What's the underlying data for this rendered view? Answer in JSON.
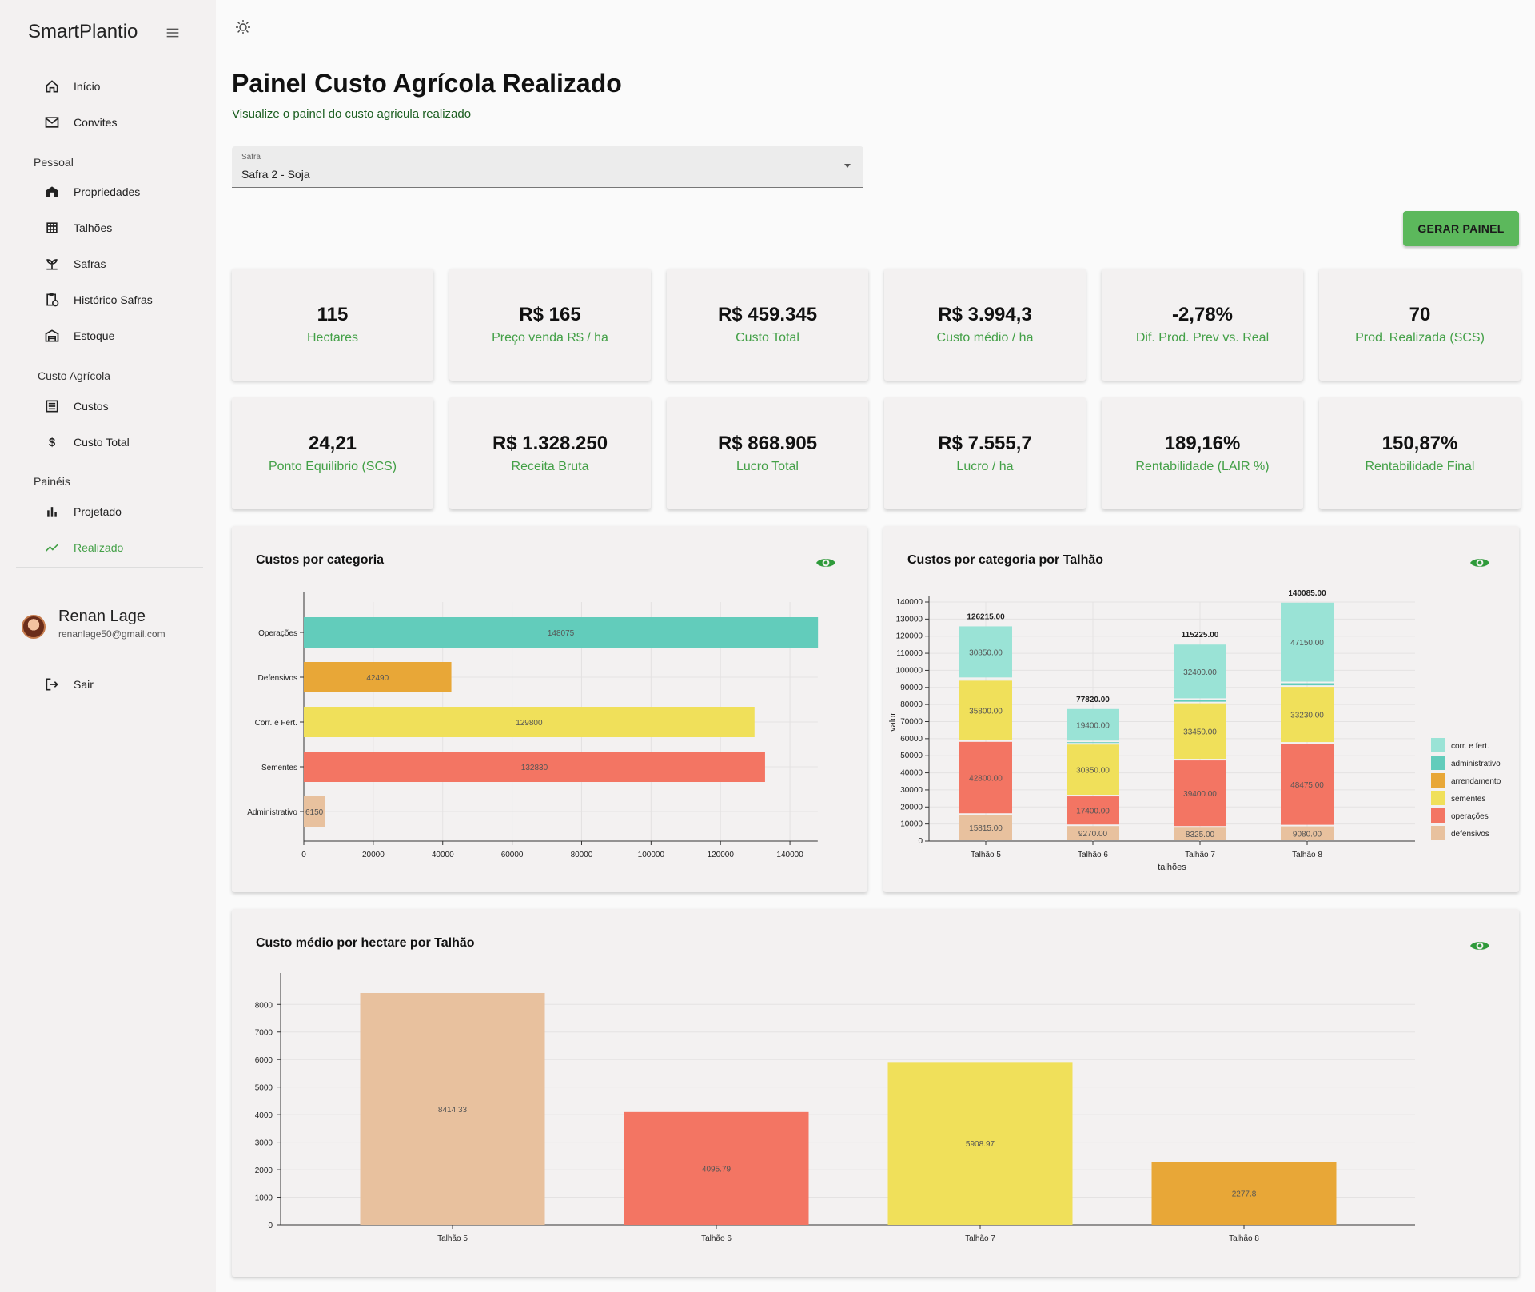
{
  "sidebar": {
    "brand": "SmartPlantio",
    "items": [
      {
        "label": "Início",
        "icon": "home-icon"
      },
      {
        "label": "Convites",
        "icon": "mail-icon"
      },
      {
        "label": "Propriedades",
        "icon": "barn-icon"
      },
      {
        "label": "Talhões",
        "icon": "grid-icon"
      },
      {
        "label": "Safras",
        "icon": "sprout-icon"
      },
      {
        "label": "Histórico Safras",
        "icon": "clipboard-history-icon"
      },
      {
        "label": "Estoque",
        "icon": "warehouse-icon"
      },
      {
        "label": "Custos",
        "icon": "list-icon"
      },
      {
        "label": "Custo Total",
        "icon": "dollar-icon"
      },
      {
        "label": "Projetado",
        "icon": "bar-chart-icon"
      },
      {
        "label": "Realizado",
        "icon": "trending-up-icon"
      }
    ],
    "sections": {
      "pessoal": "Pessoal",
      "custo": "Custo Agrícola",
      "paineis": "Painéis"
    },
    "user": {
      "name": "Renan Lage",
      "email": "renanlage50@gmail.com"
    },
    "logout": "Sair"
  },
  "header": {
    "title": "Painel Custo Agrícola Realizado",
    "subtitle": "Visualize o painel do custo agricula realizado"
  },
  "safra_select": {
    "label": "Safra",
    "value": "Safra 2 - Soja"
  },
  "generate_button": "GERAR PAINEL",
  "kpis": [
    {
      "value": "115",
      "label": "Hectares"
    },
    {
      "value": "R$ 165",
      "label": "Preço venda R$ / ha"
    },
    {
      "value": "R$ 459.345",
      "label": "Custo Total"
    },
    {
      "value": "R$ 3.994,3",
      "label": "Custo médio / ha"
    },
    {
      "value": "-2,78%",
      "label": "Dif. Prod. Prev vs. Real"
    },
    {
      "value": "70",
      "label": "Prod. Realizada (SCS)"
    },
    {
      "value": "24,21",
      "label": "Ponto Equilibrio (SCS)"
    },
    {
      "value": "R$ 1.328.250",
      "label": "Receita Bruta"
    },
    {
      "value": "R$ 868.905",
      "label": "Lucro Total"
    },
    {
      "value": "R$ 7.555,7",
      "label": "Lucro / ha"
    },
    {
      "value": "189,16%",
      "label": "Rentabilidade (LAIR %)"
    },
    {
      "value": "150,87%",
      "label": "Rentabilidade Final"
    }
  ],
  "colors": {
    "green": "#43a047",
    "operacoes": "#f37563",
    "defensivos": "#e8c19e",
    "corr_fert": "#9ae3d6",
    "administrativo": "#62ccbb",
    "arrendamento": "#e8a737",
    "sementes": "#f0e05a"
  },
  "chart_data": [
    {
      "type": "bar",
      "orientation": "horizontal",
      "title": "Custos por categoria",
      "categories": [
        "Operações",
        "Defensivos",
        "Corr. e Fert.",
        "Sementes",
        "Administrativo"
      ],
      "values": [
        148075,
        42490,
        129800,
        132830,
        6150
      ],
      "bar_colors": [
        "#62ccbb",
        "#e8a737",
        "#f0e05a",
        "#f37563",
        "#e8c19e"
      ],
      "xlim": [
        0,
        150000
      ],
      "xticks": [
        0,
        20000,
        40000,
        60000,
        80000,
        100000,
        120000,
        140000
      ],
      "grid": true
    },
    {
      "type": "bar",
      "stacked": true,
      "title": "Custos por categoria por Talhão",
      "categories": [
        "Talhão 5",
        "Talhão 6",
        "Talhão 7",
        "Talhão 8"
      ],
      "xlabel": "talhões",
      "ylabel": "valor",
      "ylim": [
        0,
        140000
      ],
      "yticks": [
        0,
        10000,
        20000,
        30000,
        40000,
        50000,
        60000,
        70000,
        80000,
        90000,
        100000,
        110000,
        120000,
        130000,
        140000
      ],
      "series": [
        {
          "name": "defensivos",
          "color": "#e8c19e",
          "values": [
            15815,
            9270,
            8325,
            9080
          ],
          "labels": [
            "15815.00",
            "9270.00",
            "8325.00",
            "9080.00"
          ]
        },
        {
          "name": "operações",
          "color": "#f37563",
          "values": [
            42800,
            17400,
            39400,
            48475
          ],
          "labels": [
            "42800.00",
            "17400.00",
            "39400.00",
            "48475.00"
          ]
        },
        {
          "name": "sementes",
          "color": "#f0e05a",
          "values": [
            35800,
            30350,
            33450,
            33230
          ],
          "labels": [
            "35800.00",
            "30350.00",
            "33450.00",
            "33230.00"
          ]
        },
        {
          "name": "arrendamento",
          "color": "#e8a737",
          "values": [
            0,
            0,
            0,
            0
          ],
          "labels": [
            "",
            "",
            "",
            ""
          ]
        },
        {
          "name": "administrativo",
          "color": "#62ccbb",
          "values": [
            950,
            1400,
            1975,
            2150
          ],
          "labels": [
            "",
            "",
            "",
            ""
          ]
        },
        {
          "name": "corr. e fert.",
          "color": "#9ae3d6",
          "values": [
            30850,
            19400,
            32400,
            47150
          ],
          "labels": [
            "30850.00",
            "19400.00",
            "32400.00",
            "47150.00"
          ]
        }
      ],
      "totals": [
        "126215.00",
        "77820.00",
        "115225.00",
        "140085.00"
      ],
      "legend_order": [
        "corr. e fert.",
        "administrativo",
        "arrendamento",
        "sementes",
        "operações",
        "defensivos"
      ],
      "legend": "right",
      "grid": true
    },
    {
      "type": "bar",
      "title": "Custo médio por hectare por Talhão",
      "categories": [
        "Talhão 5",
        "Talhão 6",
        "Talhão 7",
        "Talhão 8"
      ],
      "values": [
        8414.33,
        4095.79,
        5908.97,
        2277.8
      ],
      "labels": [
        "8414.33",
        "4095.79",
        "5908.97",
        "2277.8"
      ],
      "bar_colors": [
        "#e8c19e",
        "#f37563",
        "#f0e05a",
        "#e8a737"
      ],
      "ylim": [
        0,
        8400
      ],
      "yticks": [
        0,
        1000,
        2000,
        3000,
        4000,
        5000,
        6000,
        7000,
        8000
      ],
      "grid": true
    }
  ]
}
